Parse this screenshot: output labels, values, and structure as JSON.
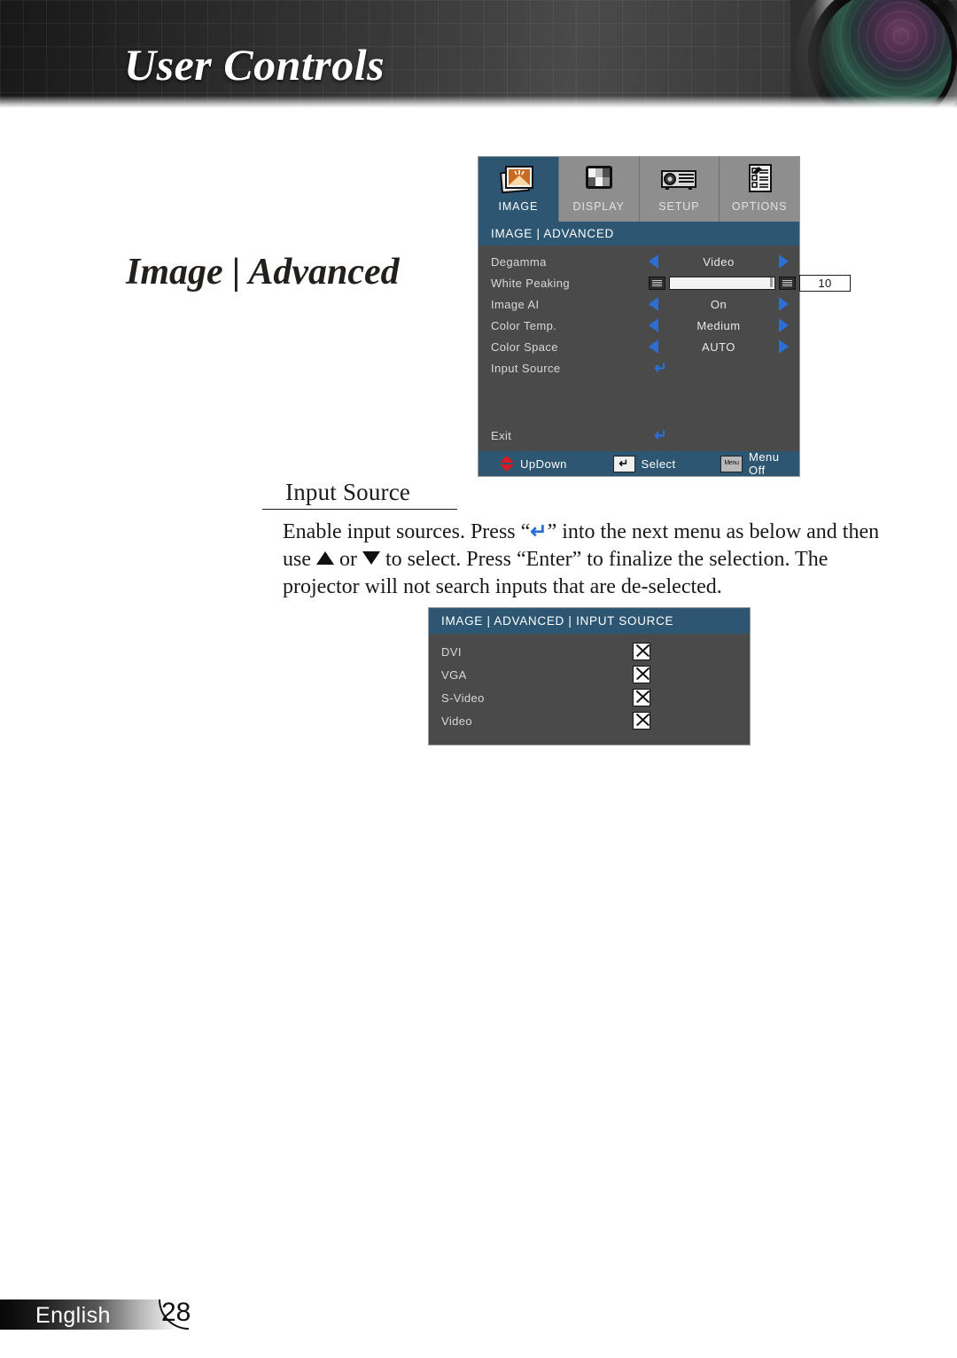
{
  "header": {
    "title": "User Controls",
    "lens_icon": "camera-lens-graphic"
  },
  "page": {
    "heading": "Image | Advanced"
  },
  "osd_main": {
    "tabs": [
      {
        "label": "IMAGE",
        "icon": "image-photo-icon",
        "active": true
      },
      {
        "label": "DISPLAY",
        "icon": "display-checker-icon",
        "active": false
      },
      {
        "label": "SETUP",
        "icon": "setup-projector-icon",
        "active": false
      },
      {
        "label": "OPTIONS",
        "icon": "options-checklist-icon",
        "active": false
      }
    ],
    "title": "IMAGE | ADVANCED",
    "rows": [
      {
        "label": "Degamma",
        "type": "spinner",
        "value": "Video"
      },
      {
        "label": "White Peaking",
        "type": "slider",
        "value": "10"
      },
      {
        "label": "Image AI",
        "type": "spinner",
        "value": "On"
      },
      {
        "label": "Color Temp.",
        "type": "spinner",
        "value": "Medium"
      },
      {
        "label": "Color Space",
        "type": "spinner",
        "value": "AUTO"
      },
      {
        "label": "Input Source",
        "type": "enter",
        "value": "↵"
      }
    ],
    "exit_label": "Exit",
    "exit_glyph": "↵",
    "footer": {
      "updown_label": "UpDown",
      "select_label": "Select",
      "select_key_glyph": "↵",
      "menuoff_label": "Menu Off",
      "menu_key_glyph": "Menu"
    },
    "colors": {
      "title_blue": "#2c5672",
      "body_gray": "#4a4a4a",
      "tab_gray": "#8e8e8e",
      "arrow_blue": "#2b6fd6",
      "updown_red": "#d81b20"
    }
  },
  "section": {
    "heading": "Input Source",
    "paragraph_part1": "Enable input sources. Press “",
    "paragraph_part2": "” into the next menu as below and then use ",
    "paragraph_part3": " or ",
    "paragraph_part4": " to select. Press “Enter” to finalize the selection. The projector will not search inputs that are de-selected."
  },
  "osd_input_source": {
    "title": "IMAGE | ADVANCED | INPUT SOURCE",
    "rows": [
      {
        "label": "DVI",
        "checked": "X"
      },
      {
        "label": "VGA",
        "checked": "X"
      },
      {
        "label": "S-Video",
        "checked": "X"
      },
      {
        "label": "Video",
        "checked": "X"
      }
    ]
  },
  "footer": {
    "language": "English",
    "page_number": "28"
  }
}
